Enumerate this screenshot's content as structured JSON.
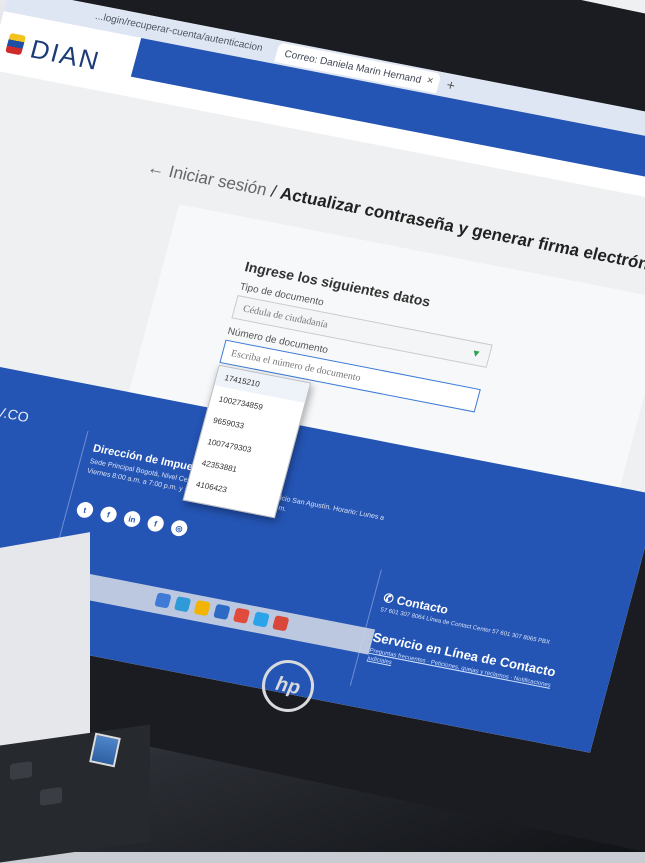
{
  "browser": {
    "url": "...login/recuperar-cuenta/autenticacion",
    "tab_title": "Correo: Daniela Marin Hernand",
    "tab_close": "×",
    "tab_new": "+"
  },
  "header": {
    "logo_text": "DIAN"
  },
  "breadcrumb": {
    "back_label": "← Iniciar sesión",
    "separator": " / ",
    "current": "Actualizar contraseña y generar firma electróni"
  },
  "form": {
    "title": "Ingrese los siguientes datos",
    "doc_type_label": "Tipo de documento",
    "doc_type_value": "Cédula de ciudadanía",
    "doc_number_label": "Número de documento",
    "doc_number_placeholder": "Escriba el número de documento"
  },
  "autocomplete": {
    "items": [
      "17415210",
      "1002734859",
      "9659033",
      "1007479303",
      "42353881",
      "4106423"
    ]
  },
  "footer": {
    "govco": "GOV.CO",
    "co_badge": "CO",
    "direccion_title": "Dirección de Impuestos",
    "direccion_text": "Sede Principal Bogotá, Nivel Central, carrera 8 N° 6C - 38 Edificio San Agustín. Horario: Lunes a Viernes 8:00 a.m. a 7:00 p.m. y Sábados de 8:00 a.m. a 12:00 m.",
    "social": [
      "t",
      "f",
      "in",
      "f",
      "◎"
    ],
    "contact_title": "Contacto",
    "contact_text": "57 601 307 8064 Línea de Contact Center 57 601 307 8065 PBX",
    "service_title": "Servicio en Línea de Contacto",
    "contact_links": "Preguntas frecuentes · Peticiones, quejas y reclamos · Notificaciones judiciales"
  },
  "colors": {
    "primary_blue": "#2454b4",
    "header_text": "#1b3b78",
    "active_border": "#3c7bd6"
  },
  "hardware": {
    "brand": "hp"
  }
}
